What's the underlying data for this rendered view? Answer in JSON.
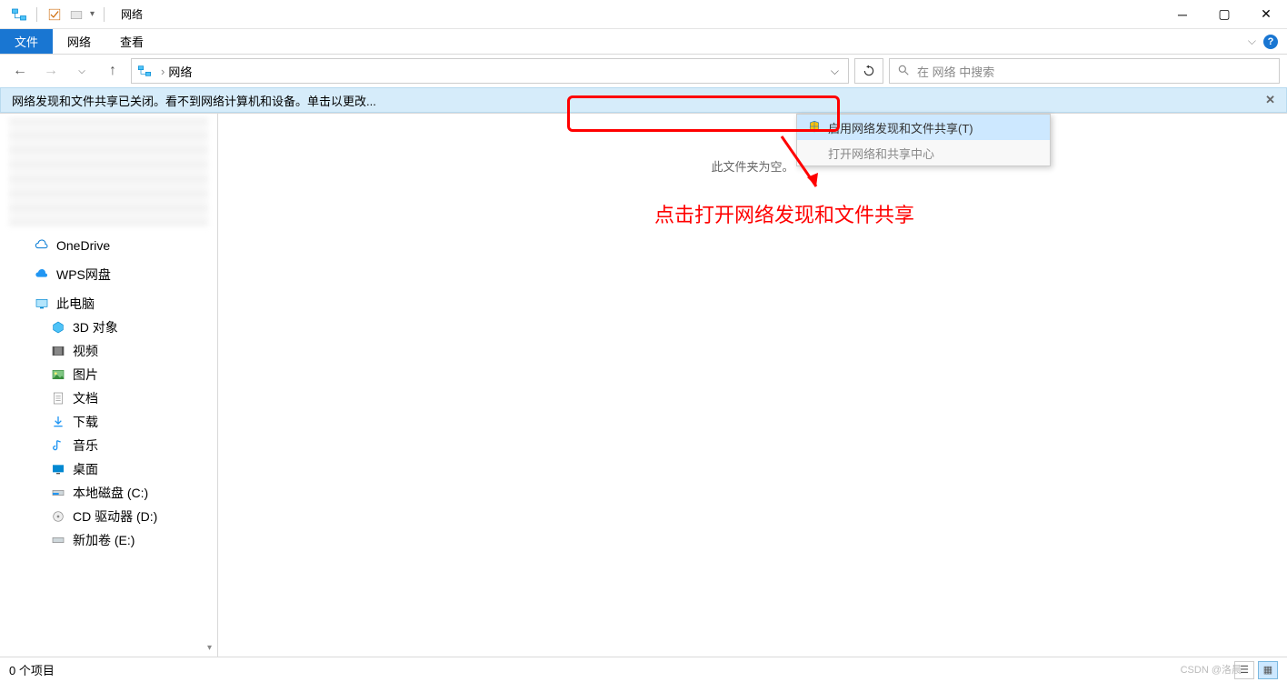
{
  "titlebar": {
    "title": "网络"
  },
  "ribbon": {
    "file": "文件",
    "network": "网络",
    "view": "查看"
  },
  "nav": {
    "breadcrumb": "网络"
  },
  "search": {
    "placeholder": "在 网络 中搜索"
  },
  "infobar": {
    "text": "网络发现和文件共享已关闭。看不到网络计算机和设备。单击以更改..."
  },
  "sidebar": {
    "onedrive": "OneDrive",
    "wps": "WPS网盘",
    "thispc": "此电脑",
    "items": [
      {
        "label": "3D 对象"
      },
      {
        "label": "视频"
      },
      {
        "label": "图片"
      },
      {
        "label": "文档"
      },
      {
        "label": "下载"
      },
      {
        "label": "音乐"
      },
      {
        "label": "桌面"
      },
      {
        "label": "本地磁盘 (C:)"
      },
      {
        "label": "CD 驱动器 (D:)"
      },
      {
        "label": "新加卷 (E:)"
      }
    ]
  },
  "content": {
    "empty": "此文件夹为空。",
    "menu_enable": "启用网络发现和文件共享(T)",
    "menu_open": "打开网络和共享中心"
  },
  "annotation": {
    "text": "点击打开网络发现和文件共享"
  },
  "status": {
    "items": "0 个项目"
  },
  "watermark": "CSDN @洛晨"
}
